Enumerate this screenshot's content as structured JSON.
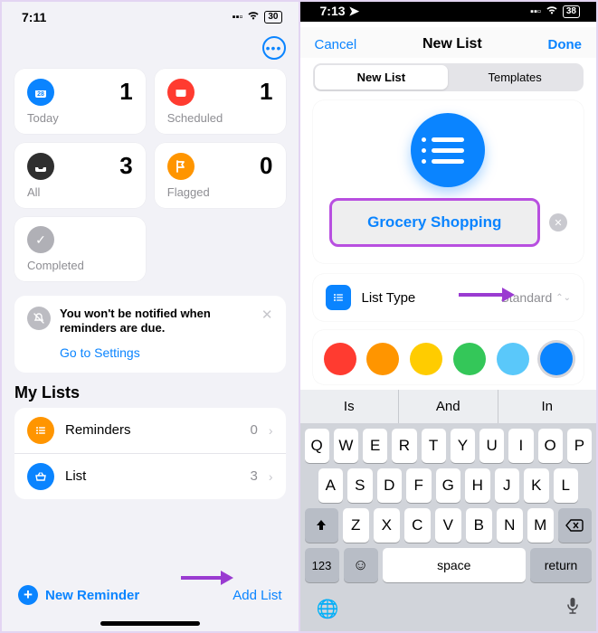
{
  "left": {
    "status": {
      "time": "7:11",
      "battery": "30"
    },
    "cards": {
      "today": {
        "label": "Today",
        "count": "1"
      },
      "scheduled": {
        "label": "Scheduled",
        "count": "1"
      },
      "all": {
        "label": "All",
        "count": "3"
      },
      "flagged": {
        "label": "Flagged",
        "count": "0"
      },
      "completed": {
        "label": "Completed"
      }
    },
    "notice": {
      "text": "You won't be notified when reminders are due.",
      "link": "Go to Settings"
    },
    "lists_title": "My Lists",
    "lists": [
      {
        "name": "Reminders",
        "count": "0"
      },
      {
        "name": "List",
        "count": "3"
      }
    ],
    "bottom": {
      "new_reminder": "New Reminder",
      "add_list": "Add List"
    }
  },
  "right": {
    "status": {
      "time": "7:13",
      "battery": "38"
    },
    "nav": {
      "cancel": "Cancel",
      "title": "New List",
      "done": "Done"
    },
    "seg": {
      "new": "New List",
      "templates": "Templates"
    },
    "name_value": "Grocery Shopping",
    "type": {
      "label": "List Type",
      "value": "Standard"
    },
    "colors": [
      "#ff3b30",
      "#ff9500",
      "#ffcc00",
      "#34c759",
      "#5ac8fa",
      "#0a84ff"
    ],
    "selected_color_index": 5,
    "suggestions": [
      "Is",
      "And",
      "In"
    ],
    "keyboard": {
      "r1": [
        "Q",
        "W",
        "E",
        "R",
        "T",
        "Y",
        "U",
        "I",
        "O",
        "P"
      ],
      "r2": [
        "A",
        "S",
        "D",
        "F",
        "G",
        "H",
        "J",
        "K",
        "L"
      ],
      "r3": [
        "Z",
        "X",
        "C",
        "V",
        "B",
        "N",
        "M"
      ],
      "num": "123",
      "space": "space",
      "return": "return"
    }
  }
}
